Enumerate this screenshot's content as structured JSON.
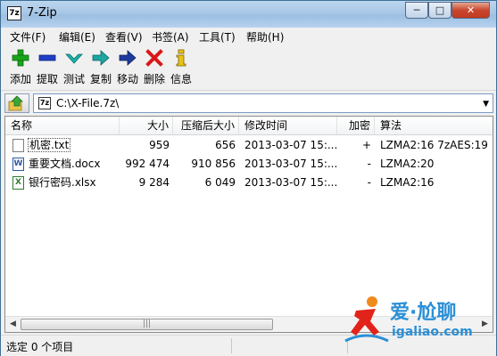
{
  "window": {
    "title": "7-Zip",
    "app_icon_text": "7z"
  },
  "menu": [
    "文件(F)",
    "编辑(E)",
    "查看(V)",
    "书签(A)",
    "工具(T)",
    "帮助(H)"
  ],
  "toolbar": {
    "add": "添加",
    "extract": "提取",
    "test": "测试",
    "copy": "复制",
    "move": "移动",
    "delete": "删除",
    "info": "信息"
  },
  "address": {
    "path": "C:\\X-File.7z\\"
  },
  "columns": {
    "name": "名称",
    "size": "大小",
    "packed": "压缩后大小",
    "modified": "修改时间",
    "encrypted": "加密",
    "method": "算法"
  },
  "files": [
    {
      "name": "机密.txt",
      "size": "959",
      "packed": "656",
      "modified": "2013-03-07 15:...",
      "encrypted": "+",
      "method": "LZMA2:16 7zAES:19",
      "type": "text"
    },
    {
      "name": "重要文档.docx",
      "size": "992 474",
      "packed": "910 856",
      "modified": "2013-03-07 15:...",
      "encrypted": "-",
      "method": "LZMA2:20",
      "type": "word"
    },
    {
      "name": "银行密码.xlsx",
      "size": "9 284",
      "packed": "6 049",
      "modified": "2013-03-07 15:...",
      "encrypted": "-",
      "method": "LZMA2:16",
      "type": "excel"
    }
  ],
  "status": {
    "text": "选定 0 个项目"
  },
  "watermark": {
    "top": "爱·尬聊",
    "bottom": "igaliao.com"
  },
  "colors": {
    "titlebar": "#a8c6e6",
    "close_button": "#c8462e",
    "watermark": "#2b8fd6"
  }
}
